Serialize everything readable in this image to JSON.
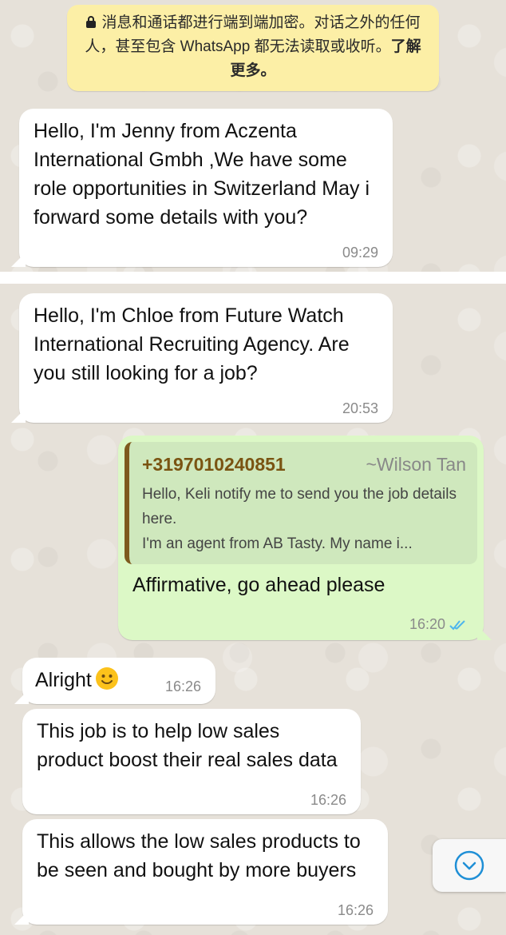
{
  "notice": {
    "text": "消息和通话都进行端到端加密。对话之外的任何人，甚至包含 WhatsApp 都无法读取或收听。",
    "more": "了解更多。"
  },
  "messages_top": [
    {
      "text": "Hello, I'm Jenny from Aczenta International Gmbh ,We have some role opportunities in Switzerland May i forward some details with you?",
      "time": "09:29"
    }
  ],
  "messages_bottom": [
    {
      "text": "Hello, I'm Chloe  from Future Watch International Recruiting Agency.  Are you still looking for a job?",
      "time": "20:53"
    },
    {
      "quote_number": "+3197010240851",
      "quote_name": "~Wilson Tan",
      "quote_line1": "Hello, Keli notify me to send you the job details here.",
      "quote_line2": "I'm an agent from AB Tasty. My name i...",
      "text": "Affirmative, go ahead please",
      "time": "16:20"
    },
    {
      "text": "Alright",
      "emoji": "slightly-smiling-face",
      "time": "16:26"
    },
    {
      "text": "This job is to help low sales product boost their real sales data",
      "time": "16:26"
    },
    {
      "text": "This allows the low sales products to be seen and bought by more buyers",
      "time": "16:26"
    }
  ],
  "icons": {
    "lock": "lock-icon",
    "read_receipt": "double-check-icon",
    "scroll_down": "chevron-down-circle-icon"
  },
  "colors": {
    "wallpaper": "#e6e1d9",
    "incoming": "#ffffff",
    "outgoing": "#dcf8c6",
    "notice": "#fcefa6",
    "quote_accent": "#7e5a1e",
    "read_tick": "#4fb6ec"
  }
}
